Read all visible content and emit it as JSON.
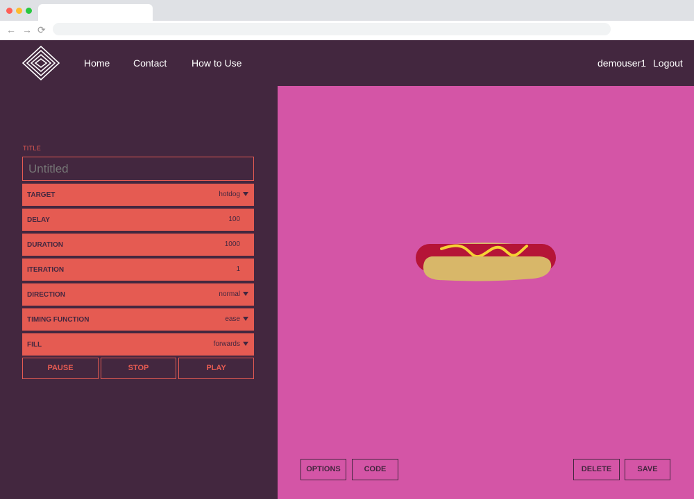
{
  "browser": {
    "back_glyph": "←",
    "forward_glyph": "→",
    "reload_glyph": "⟳"
  },
  "header": {
    "nav": [
      {
        "label": "Home"
      },
      {
        "label": "Contact"
      },
      {
        "label": "How to Use"
      }
    ],
    "username": "demouser1",
    "logout_label": "Logout"
  },
  "panel": {
    "title_label": "TITLE",
    "title_placeholder": "Untitled",
    "options": [
      {
        "label": "TARGET",
        "value": "hotdog"
      },
      {
        "label": "DELAY",
        "value": "100"
      },
      {
        "label": "DURATION",
        "value": "1000"
      },
      {
        "label": "ITERATION",
        "value": "1"
      },
      {
        "label": "DIRECTION",
        "value": "normal"
      },
      {
        "label": "TIMING FUNCTION",
        "value": "ease"
      },
      {
        "label": "FILL",
        "value": "forwards"
      }
    ],
    "controls": {
      "pause": "PAUSE",
      "stop": "STOP",
      "play": "PLAY"
    }
  },
  "stage": {
    "buttons": {
      "options": "OPTIONS",
      "code": "CODE",
      "delete": "DELETE",
      "save": "SAVE"
    }
  },
  "colors": {
    "background": "#43273f",
    "accent": "#e55b52",
    "stage": "#d455a6",
    "bun": "#d8b769",
    "sausage": "#b51437",
    "mustard": "#f5d235"
  },
  "icons": [
    "logo-icon",
    "chevron-down-icon",
    "back-icon",
    "forward-icon",
    "reload-icon"
  ]
}
